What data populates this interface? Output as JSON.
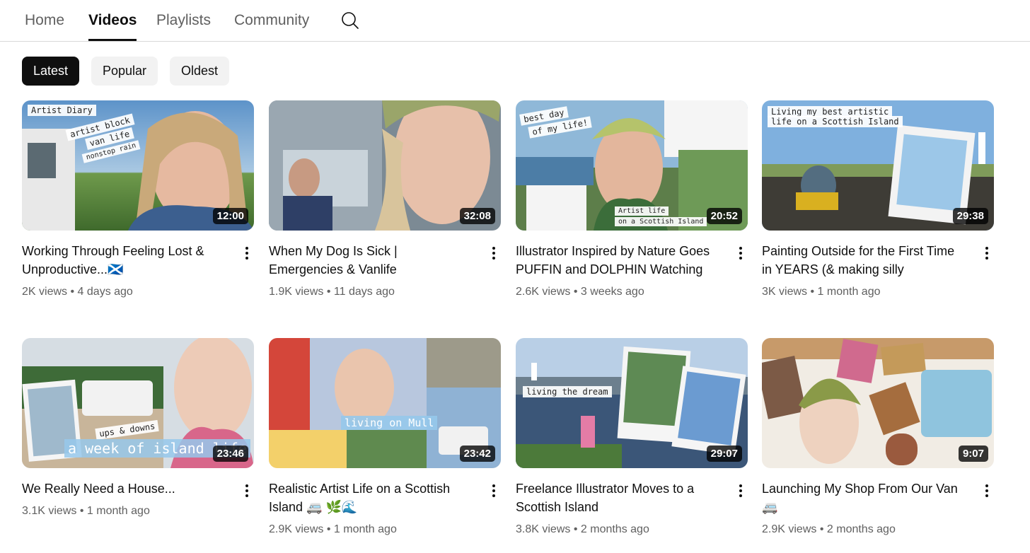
{
  "tabs": [
    {
      "label": "Home",
      "active": false
    },
    {
      "label": "Videos",
      "active": true
    },
    {
      "label": "Playlists",
      "active": false
    },
    {
      "label": "Community",
      "active": false
    }
  ],
  "search_icon": "search-icon",
  "chips": [
    {
      "label": "Latest",
      "active": true
    },
    {
      "label": "Popular",
      "active": false
    },
    {
      "label": "Oldest",
      "active": false
    }
  ],
  "videos": [
    {
      "title": "Working Through Feeling Lost & Unproductive...🏴󠁧󠁢󠁳󠁣󠁴󠁿",
      "views": "2K views",
      "age": "4 days ago",
      "duration": "12:00",
      "overlays": [
        "Artist Diary",
        "artist block",
        "van life",
        "nonstop rain"
      ]
    },
    {
      "title": "When My Dog Is Sick | Emergencies & Vanlife",
      "views": "1.9K views",
      "age": "11 days ago",
      "duration": "32:08",
      "overlays": []
    },
    {
      "title": "Illustrator Inspired by Nature Goes PUFFIN and DOLPHIN Watching",
      "views": "2.6K views",
      "age": "3 weeks ago",
      "duration": "20:52",
      "overlays": [
        "best day",
        "of my life!",
        "Artist life",
        "on a Scottish Island"
      ]
    },
    {
      "title": "Painting Outside for the First Time in YEARS (& making silly mistakes…",
      "views": "3K views",
      "age": "1 month ago",
      "duration": "29:38",
      "overlays": [
        "Living my best artistic",
        "life on a Scottish Island"
      ]
    },
    {
      "title": "We Really Need a House...",
      "views": "3.1K views",
      "age": "1 month ago",
      "duration": "23:46",
      "overlays": [
        "ups & downs",
        "a week of island life"
      ]
    },
    {
      "title": "Realistic Artist Life on a Scottish Island 🚐 🌿🌊",
      "views": "2.9K views",
      "age": "1 month ago",
      "duration": "23:42",
      "overlays": [
        "living on Mull"
      ]
    },
    {
      "title": "Freelance Illustrator Moves to a Scottish Island",
      "views": "3.8K views",
      "age": "2 months ago",
      "duration": "29:07",
      "overlays": [
        "living the dream"
      ]
    },
    {
      "title": "Launching My Shop From Our Van 🚐",
      "views": "2.9K views",
      "age": "2 months ago",
      "duration": "9:07",
      "overlays": []
    }
  ],
  "meta_separator": "•",
  "colors": {
    "text": "#0f0f0f",
    "secondary": "#606060",
    "chip_bg": "#f2f2f2",
    "chip_active_bg": "#0f0f0f"
  }
}
